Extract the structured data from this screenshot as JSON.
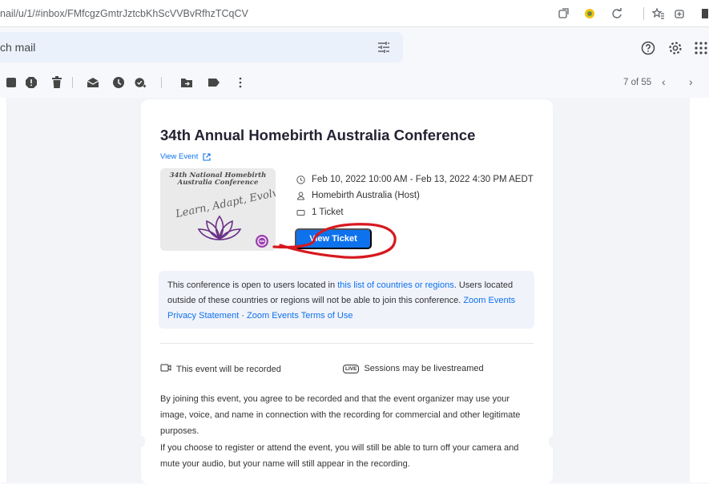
{
  "browser": {
    "url": "nail/u/1/#inbox/FMfcgzGmtrJztcbKhScVVBvRfhzTCqCV",
    "icons": [
      "tab-search-icon",
      "extension-icon",
      "reload-extension-icon",
      "favorites-icon",
      "collections-icon",
      "profile-icon"
    ]
  },
  "gmail": {
    "search_placeholder": "ch mail",
    "toolbar_icons": [
      "archive-icon",
      "report-spam-icon",
      "delete-icon",
      "mark-unread-icon",
      "snooze-icon",
      "add-to-tasks-icon",
      "move-to-icon",
      "label-icon",
      "more-icon"
    ],
    "pager": "7 of 55",
    "top_icons": [
      "help-icon",
      "settings-icon",
      "apps-icon"
    ]
  },
  "email": {
    "title": "34th Annual Homebirth Australia Conference",
    "view_event": "View Event",
    "thumbnail": {
      "line1": "34th National Homebirth",
      "line2": "Australia Conference",
      "line3": "Learn, Adapt, Evolve"
    },
    "date": "Feb 10, 2022 10:00 AM - Feb 13, 2022 4:30 PM AEDT",
    "host": "Homebirth Australia (Host)",
    "tickets": "1 Ticket",
    "view_ticket_button": "View Ticket",
    "notice": {
      "p1": "This conference is open to users located in ",
      "link1": "this list of countries or regions",
      "p2": ". Users located outside of these countries or regions will not be able to join this conference. ",
      "link2": "Zoom Events Privacy Statement",
      "p3": " · ",
      "link3": "Zoom Events Terms of Use"
    },
    "recorded": "This event will be recorded",
    "live_badge": "LIVE",
    "livestream": "Sessions may be livestreamed",
    "para1": "By joining this event, you agree to be recorded and that the event organizer may use your image, voice, and name in connection with the recording for commercial and other legitimate purposes.",
    "para2": "If you choose to register or attend the event, you will still be able to turn off your camera and mute your audio, but your name will still appear in the recording."
  },
  "colors": {
    "accent": "#0e72ed",
    "annotation": "#d7191f"
  }
}
